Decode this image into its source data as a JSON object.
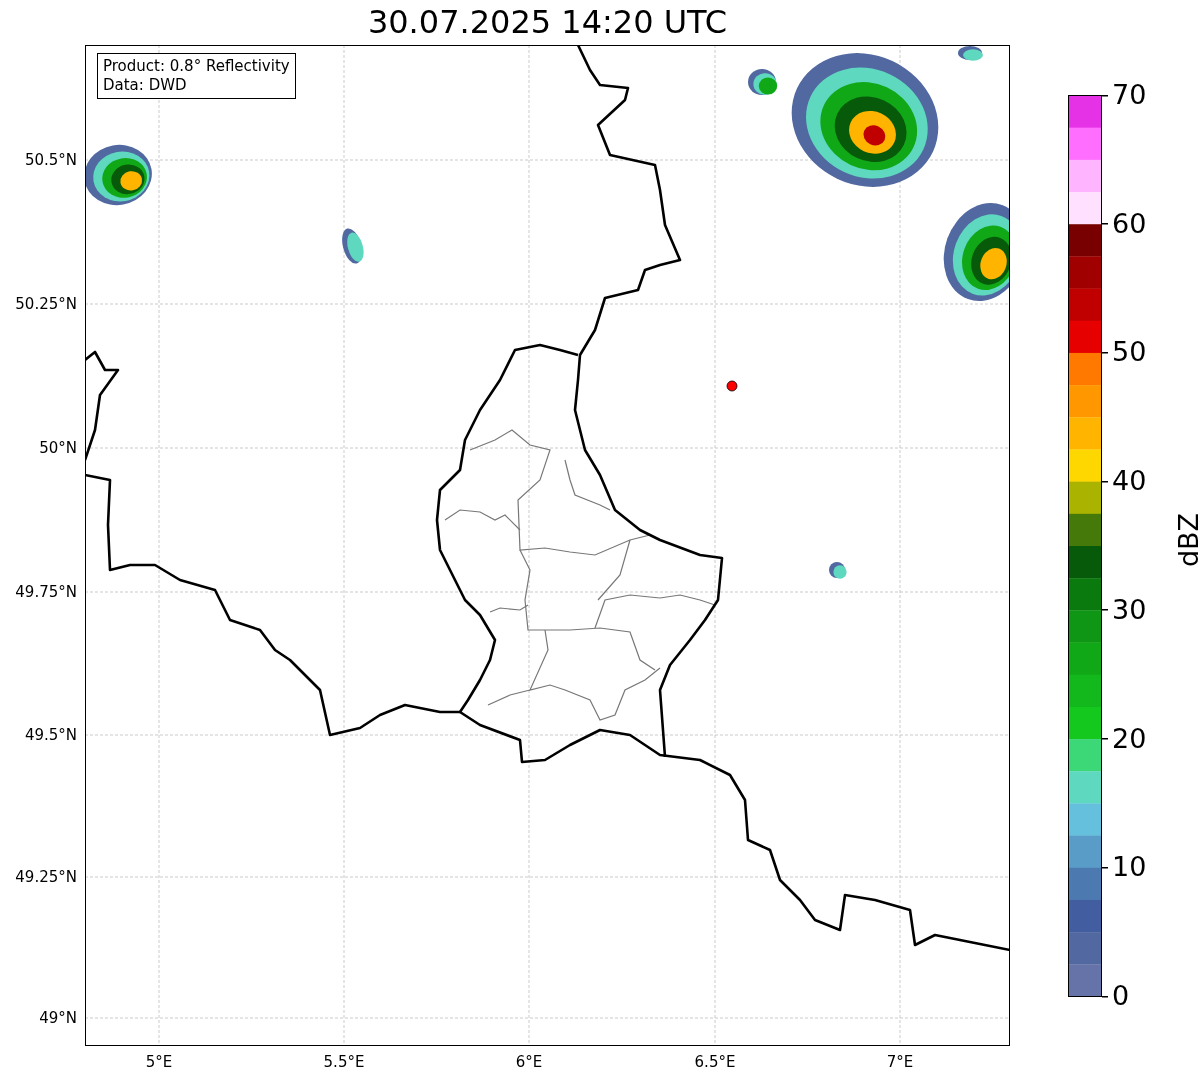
{
  "title": "30.07.2025 14:20 UTC",
  "legend": {
    "lines": [
      "Product: 0.8° Reflectivity",
      "Data: DWD"
    ]
  },
  "map": {
    "xticks": [
      "5°E",
      "5.5°E",
      "6°E",
      "6.5°E",
      "7°E"
    ],
    "yticks": [
      "50.5°N",
      "50.25°N",
      "50°N",
      "49.75°N",
      "49.5°N",
      "49.25°N",
      "49°N"
    ]
  },
  "colorbar": {
    "label": "dBZ",
    "ticks": [
      "70",
      "60",
      "50",
      "40",
      "30",
      "20",
      "10",
      "0"
    ],
    "bands": [
      {
        "color": "#e632e6"
      },
      {
        "color": "#ff6eff"
      },
      {
        "color": "#ffb4ff"
      },
      {
        "color": "#ffe0ff"
      },
      {
        "color": "#780000"
      },
      {
        "color": "#a00000"
      },
      {
        "color": "#c00000"
      },
      {
        "color": "#e60000"
      },
      {
        "color": "#ff7800"
      },
      {
        "color": "#ff9800"
      },
      {
        "color": "#ffb400"
      },
      {
        "color": "#ffd700"
      },
      {
        "color": "#aab400"
      },
      {
        "color": "#457a0a"
      },
      {
        "color": "#075a0a"
      },
      {
        "color": "#0a7a0e"
      },
      {
        "color": "#0e9614"
      },
      {
        "color": "#10a816"
      },
      {
        "color": "#12b81c"
      },
      {
        "color": "#14c81e"
      },
      {
        "color": "#3cd878"
      },
      {
        "color": "#5fd8c0"
      },
      {
        "color": "#64c0dc"
      },
      {
        "color": "#5a9cc8"
      },
      {
        "color": "#4c7ab0"
      },
      {
        "color": "#435ea0"
      },
      {
        "color": "#5168a0"
      },
      {
        "color": "#6673a8"
      }
    ]
  }
}
